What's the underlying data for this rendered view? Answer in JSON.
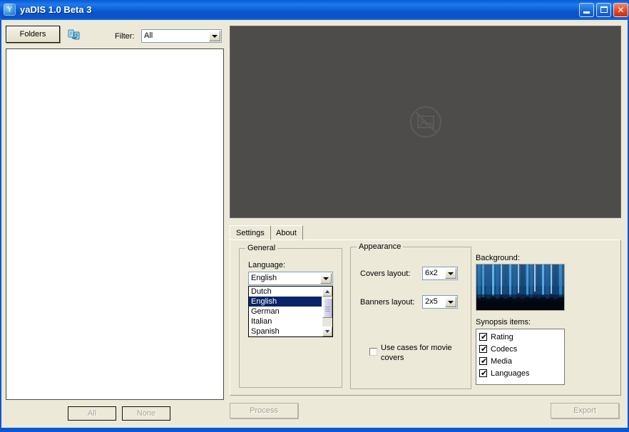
{
  "window": {
    "title": "yaDIS 1.0 Beta 3",
    "icon": "app-icon",
    "minimize_label": "",
    "maximize_label": "",
    "close_label": "✕"
  },
  "toolbar": {
    "folders_label": "Folders",
    "refresh_icon": "refresh-icon",
    "filter_label": "Filter:",
    "filter_value": "All",
    "filter_options": [
      "All"
    ]
  },
  "file_list": {
    "items": [],
    "all_label": "All",
    "none_label": "None"
  },
  "preview": {
    "placeholder_icon": "no-image-icon",
    "background_color": "#4e4b4b"
  },
  "tabs": [
    {
      "label": "Settings",
      "active": true
    },
    {
      "label": "About",
      "active": false
    }
  ],
  "general": {
    "title": "General",
    "language_label": "Language:",
    "language_value": "English",
    "language_options": [
      {
        "label": "Dutch",
        "selected": false
      },
      {
        "label": "English",
        "selected": true
      },
      {
        "label": "German",
        "selected": false
      },
      {
        "label": "Italian",
        "selected": false
      },
      {
        "label": "Spanish",
        "selected": false
      }
    ],
    "dropdown_open": true
  },
  "appearance": {
    "title": "Appearance",
    "covers_layout_label": "Covers layout:",
    "covers_layout_value": "6x2",
    "banners_layout_label": "Banners layout:",
    "banners_layout_value": "2x5",
    "use_cases_label": "Use cases for movie covers",
    "use_cases_checked": false
  },
  "background": {
    "label": "Background:",
    "preview_colors": [
      "#0a2a52",
      "#1e7fd6",
      "#4cb6f2",
      "#061524"
    ]
  },
  "synopsis": {
    "label": "Synopsis items:",
    "items": [
      {
        "label": "Rating",
        "checked": true
      },
      {
        "label": "Codecs",
        "checked": true
      },
      {
        "label": "Media",
        "checked": true
      },
      {
        "label": "Languages",
        "checked": true
      }
    ],
    "check_glyph": "✔"
  },
  "footer": {
    "process_label": "Process",
    "process_enabled": false,
    "export_label": "Export",
    "export_enabled": false
  },
  "colors": {
    "titlebar_blue": "#0a57d6",
    "face": "#ece9d8",
    "preview_gray": "#4e4b4b",
    "selection_blue": "#0a246a"
  }
}
